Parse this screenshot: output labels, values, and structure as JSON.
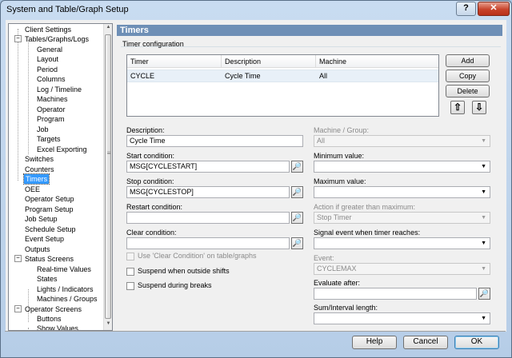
{
  "window": {
    "title": "System and Table/Graph Setup",
    "help_glyph": "?",
    "close_glyph": "✕"
  },
  "tree": {
    "items": [
      "Client Settings",
      "Tables/Graphs/Logs",
      "General",
      "Layout",
      "Period",
      "Columns",
      "Log / Timeline",
      "Machines",
      "Operator",
      "Program",
      "Job",
      "Targets",
      "Excel Exporting",
      "Switches",
      "Counters",
      "Timers",
      "OEE",
      "Operator Setup",
      "Program Setup",
      "Job Setup",
      "Schedule Setup",
      "Event Setup",
      "Outputs",
      "Status Screens",
      "Real-time Values",
      "States",
      "Lights / Indicators",
      "Machines / Groups",
      "Operator Screens",
      "Buttons",
      "Show Values"
    ],
    "selected": "Timers",
    "expander_glyph": "−"
  },
  "panel": {
    "header": "Timers",
    "group_title": "Timer configuration",
    "table": {
      "columns": [
        "Timer",
        "Description",
        "Machine"
      ],
      "rows": [
        [
          "CYCLE",
          "Cycle Time",
          "All"
        ]
      ]
    },
    "buttons": {
      "add": "Add",
      "copy": "Copy",
      "delete": "Delete"
    },
    "move_up_glyph": "⇧",
    "move_down_glyph": "⇩",
    "left": {
      "description_label": "Description:",
      "description_value": "Cycle Time",
      "start_label": "Start condition:",
      "start_value": "MSG[CYCLESTART]",
      "stop_label": "Stop condition:",
      "stop_value": "MSG[CYCLESTOP]",
      "restart_label": "Restart condition:",
      "restart_value": "",
      "clear_label": "Clear condition:",
      "clear_value": "",
      "use_clear_label": "Use 'Clear Condition' on table/graphs",
      "suspend_shifts_label": "Suspend when outside shifts",
      "suspend_breaks_label": "Suspend during breaks",
      "picker_glyph": "🔎"
    },
    "right": {
      "machine_group_label": "Machine / Group:",
      "machine_group_value": "All",
      "minimum_label": "Minimum value:",
      "maximum_label": "Maximum value:",
      "action_label": "Action if greater than maximum:",
      "action_value": "Stop Timer",
      "signal_label": "Signal event when timer reaches:",
      "event_label": "Event:",
      "event_value": "CYCLEMAX",
      "evaluate_label": "Evaluate after:",
      "sum_label": "Sum/Interval length:",
      "caret_glyph": "▼"
    }
  },
  "footer": {
    "help": "Help",
    "cancel": "Cancel",
    "ok": "OK"
  }
}
